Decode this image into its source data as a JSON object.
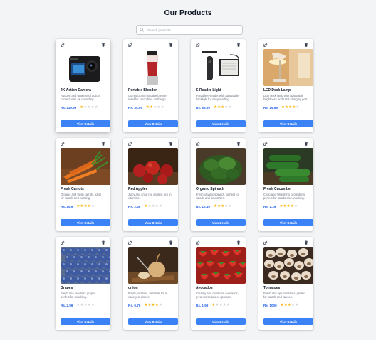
{
  "page": {
    "title": "Our Products",
    "search_placeholder": "Search products..."
  },
  "colors": {
    "background": "#f3f4f6",
    "accent": "#3b82f6",
    "price": "#2563eb",
    "star": "#f5b301"
  },
  "products": [
    {
      "name": "4K Action Camera",
      "desc": "Rugged and waterproof action camera with 4K recording.",
      "price": "Rs. 119.99",
      "rating": 1,
      "button": "View Details",
      "image": "action-camera"
    },
    {
      "name": "Portable Blender",
      "desc": "Compact and portable blender ideal for smoothies on the go.",
      "price": "Rs. 34.99",
      "rating": 2,
      "button": "View Details",
      "image": "blender"
    },
    {
      "name": "E-Reader Light",
      "desc": "Portable e-reader with adjustable backlight for easy reading.",
      "price": "Rs. 89.99",
      "rating": 3,
      "button": "View Details",
      "image": "e-reader-light"
    },
    {
      "name": "LED Desk Lamp",
      "desc": "LED desk lamp with adjustable brightness and USB charging port.",
      "price": "Rs. 19.99",
      "rating": 4,
      "button": "View Details",
      "image": "desk-lamp"
    },
    {
      "name": "Fresh Carrots",
      "desc": "Organic and fresh carrots, ideal for salads and cooking.",
      "price": "Rs. 19.9",
      "rating": 4,
      "button": "View Details",
      "image": "carrots"
    },
    {
      "name": "Red Apples",
      "desc": "Juicy and crisp red apples, rich in vitamins.",
      "price": "Rs. 2.49",
      "rating": 1,
      "button": "View Details",
      "image": "apples"
    },
    {
      "name": "Organic Spinach",
      "desc": "Fresh organic spinach, perfect for salads and smoothies.",
      "price": "Rs. 12.49",
      "rating": 3,
      "button": "View Details",
      "image": "spinach"
    },
    {
      "name": "Fresh Cucumber",
      "desc": "Crisp and refreshing cucumbers, perfect for salads and snacking.",
      "price": "Rs. 1.29",
      "rating": 4,
      "button": "View Details",
      "image": "cucumbers"
    },
    {
      "name": "Grapes",
      "desc": "Fresh and seedless grapes, perfect for snacking.",
      "price": "Rs. 2.99",
      "rating": 0,
      "button": "View Details",
      "image": "grapes"
    },
    {
      "name": "onion",
      "desc": "Fresh potatoes, versatile for a variety of dishes.",
      "price": "Rs. 0.79",
      "rating": 4,
      "button": "View Details",
      "image": "onion"
    },
    {
      "name": "Avocados",
      "desc": "Creamy and nutritious avocados, great for salads or spreads.",
      "price": "Rs. 1.99",
      "rating": 1,
      "button": "View Details",
      "image": "strawberries"
    },
    {
      "name": "Tomatoes",
      "desc": "Fresh and ripe tomatoes, perfect for salads and sauces.",
      "price": "Rs. 1000",
      "rating": 3,
      "button": "View Details",
      "image": "mushrooms"
    }
  ]
}
